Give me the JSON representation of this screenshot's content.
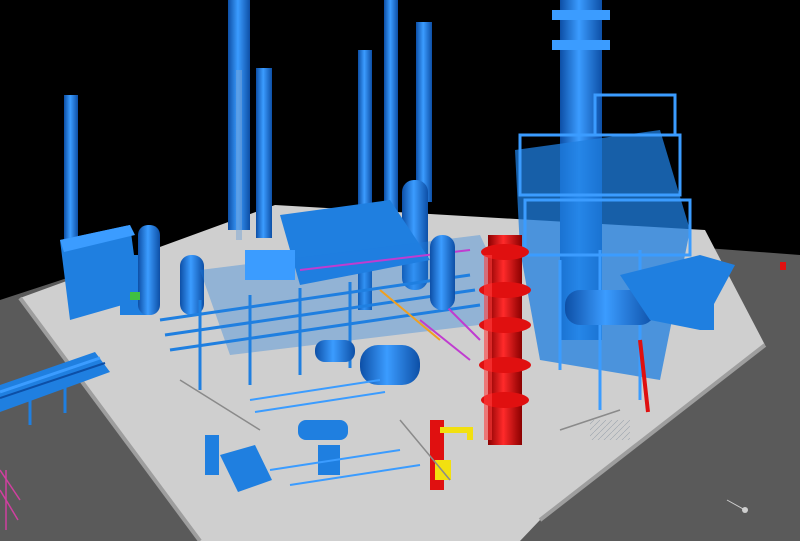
{
  "scene": {
    "colors": {
      "background": "#000000",
      "ground": "#5a5a5a",
      "slab": "#cfcfcf",
      "slab_edge": "#9e9e9e",
      "equipment_blue": "#1f7fe0",
      "equipment_blue_light": "#3b9cff",
      "equipment_blue_dark": "#0d4fa6",
      "highlight_red": "#e01010",
      "highlight_yellow": "#f2e010",
      "pipe_magenta": "#c03cd0",
      "pipe_orange": "#f0a020",
      "pipe_green": "#40c040",
      "pipe_grey": "#8a8a8a"
    },
    "icons": [
      "3d-plant-model",
      "distillation-column-icon"
    ]
  }
}
